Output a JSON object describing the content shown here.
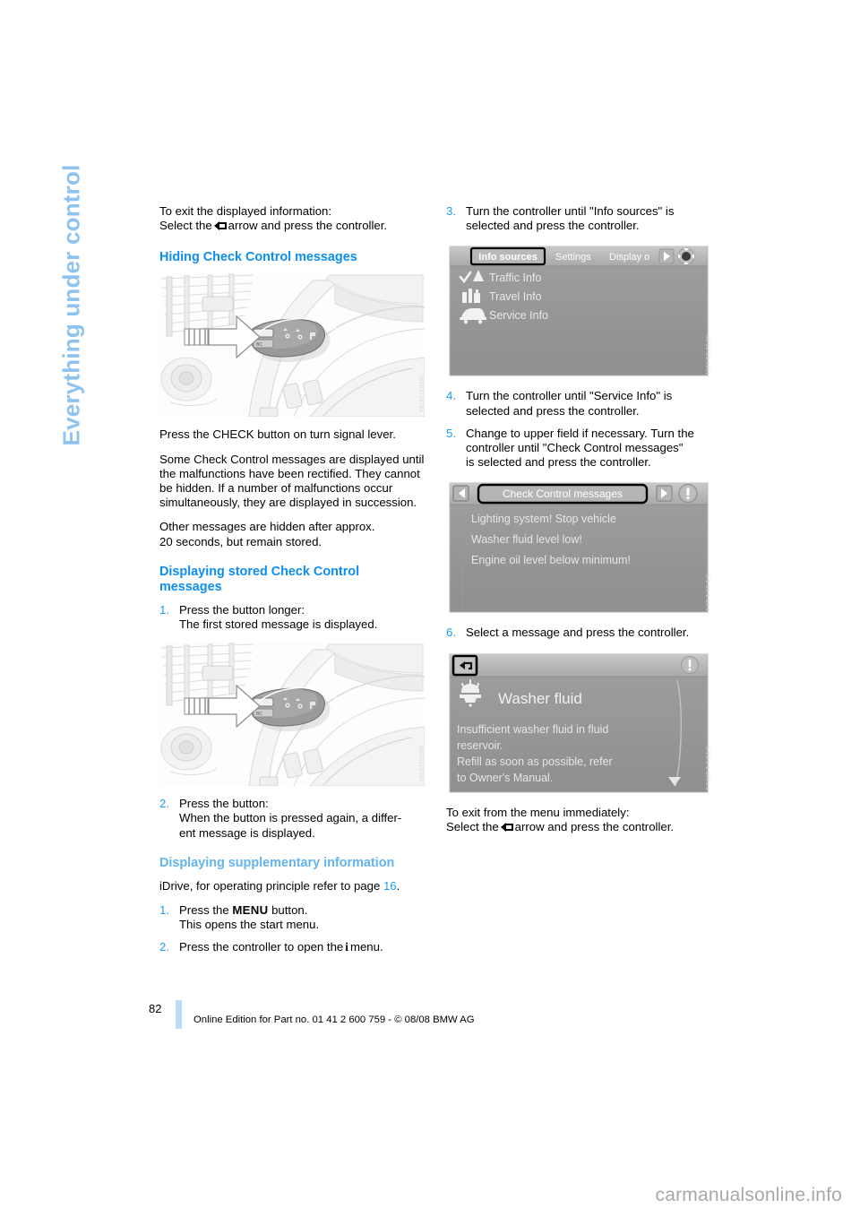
{
  "chapter_tab": {
    "label": "Everything under control"
  },
  "left_column": {
    "intro": {
      "line1": "To exit the displayed information:",
      "line2_before": "Select the",
      "line2_icon": "back-arrow-icon",
      "line2_after": "arrow and press the controller."
    },
    "heading_hiding": "Hiding Check Control messages",
    "figure_lever_1": {
      "alt": "Turn signal lever with CHECK button indicated by arrow",
      "watermark": "MK0511029A"
    },
    "para_press_check": "Press the CHECK button on turn signal lever.",
    "para_some_messages": "Some Check Control messages are displayed until the malfunctions have been rectified. They cannot be hidden. If a number of malfunctions occur simultaneously, they are displayed in succession.",
    "para_other_messages_l1": "Other messages are hidden after approx.",
    "para_other_messages_l2": "20 seconds, but remain stored.",
    "heading_displaying_stored": "Displaying stored Check Control messages",
    "steps_stored": [
      {
        "num": "1.",
        "line1": "Press the button longer:",
        "line2": "The first stored message is displayed."
      }
    ],
    "figure_lever_2": {
      "alt": "Turn signal lever with CHECK button indicated by arrow",
      "watermark": "MK0511029A"
    },
    "steps_stored2": [
      {
        "num": "2.",
        "line1": "Press the button:",
        "line2": "When the button is pressed again, a differ-",
        "line3": "ent message is displayed."
      }
    ],
    "heading_supplementary": "Displaying supplementary information",
    "para_idrive_before": "iDrive, for operating principle refer to page",
    "para_idrive_pageref": "16",
    "para_idrive_after": ".",
    "steps_supplementary": [
      {
        "num": "1.",
        "line1_before": "Press the",
        "line1_kbd": "MENU",
        "line1_after": "button.",
        "line2": "This opens the start menu."
      },
      {
        "num": "2.",
        "line1_before": "Press the controller to open the",
        "line1_kbd": "i",
        "line1_after": "menu."
      }
    ]
  },
  "right_column": {
    "steps": [
      {
        "num": "3.",
        "line1": "Turn the controller until \"Info sources\" is",
        "line2": "selected and press the controller."
      },
      {
        "num": "4.",
        "line1": "Turn the controller until \"Service Info\" is",
        "line2": "selected and press the controller."
      },
      {
        "num": "5.",
        "line1": "Change to upper field if necessary. Turn the",
        "line2": "controller until \"Check Control messages\"",
        "line3": "is selected and press the controller."
      },
      {
        "num": "6.",
        "line1": "Select a message and press the controller."
      }
    ],
    "figure_info_sources": {
      "watermark": "63.12.19.1001",
      "tabs": [
        {
          "label": "Info sources",
          "selected": true
        },
        {
          "label": "Settings",
          "selected": false
        },
        {
          "label": "Display o",
          "selected": false
        }
      ],
      "arrow_right_icon": "chevron-right-icon",
      "status_icon": "idrive-controller-icon",
      "items": [
        {
          "icon": "traffic-info-icon",
          "label": "Traffic Info"
        },
        {
          "icon": "travel-info-icon",
          "label": "Travel Info"
        },
        {
          "icon": "service-info-icon",
          "label": "Service Info"
        }
      ]
    },
    "figure_check_control_list": {
      "watermark": "5.1.19.1.19.1",
      "arrow_left_icon": "chevron-left-icon",
      "arrow_right_icon": "chevron-right-icon",
      "title": "Check Control messages",
      "status_icon": "warning-circle-icon",
      "messages": [
        "Lighting system! Stop vehicle",
        "Washer fluid level low!",
        "Engine oil level below minimum!"
      ]
    },
    "figure_washer_fluid": {
      "watermark": "5.10.1.1.1001.1",
      "back_icon": "back-arrow-icon",
      "status_icon": "warning-circle-icon",
      "item_icon": "washer-fluid-icon",
      "item_title": "Washer fluid",
      "body_lines": [
        "Insufficient washer fluid in fluid",
        "reservoir.",
        "Refill as soon as possible, refer",
        "to Owner's Manual."
      ],
      "scroll_down_icon": "chevron-down-icon"
    },
    "outro": {
      "line1": "To exit from the menu immediately:",
      "line2_before": "Select the",
      "line2_icon": "back-arrow-icon",
      "line2_after": "arrow and press the controller."
    }
  },
  "footer": {
    "page_number": "82",
    "text": "Online Edition for Part no. 01 41 2 600 759 - © 08/08 BMW AG"
  },
  "site_watermark": "carmanualsonline.info",
  "colors": {
    "heading_blue": "#0b8ef0",
    "heading_light_blue": "#62b4ee",
    "tab_blue": "#8ec3f0",
    "footer_rule": "#bcdcf5"
  }
}
